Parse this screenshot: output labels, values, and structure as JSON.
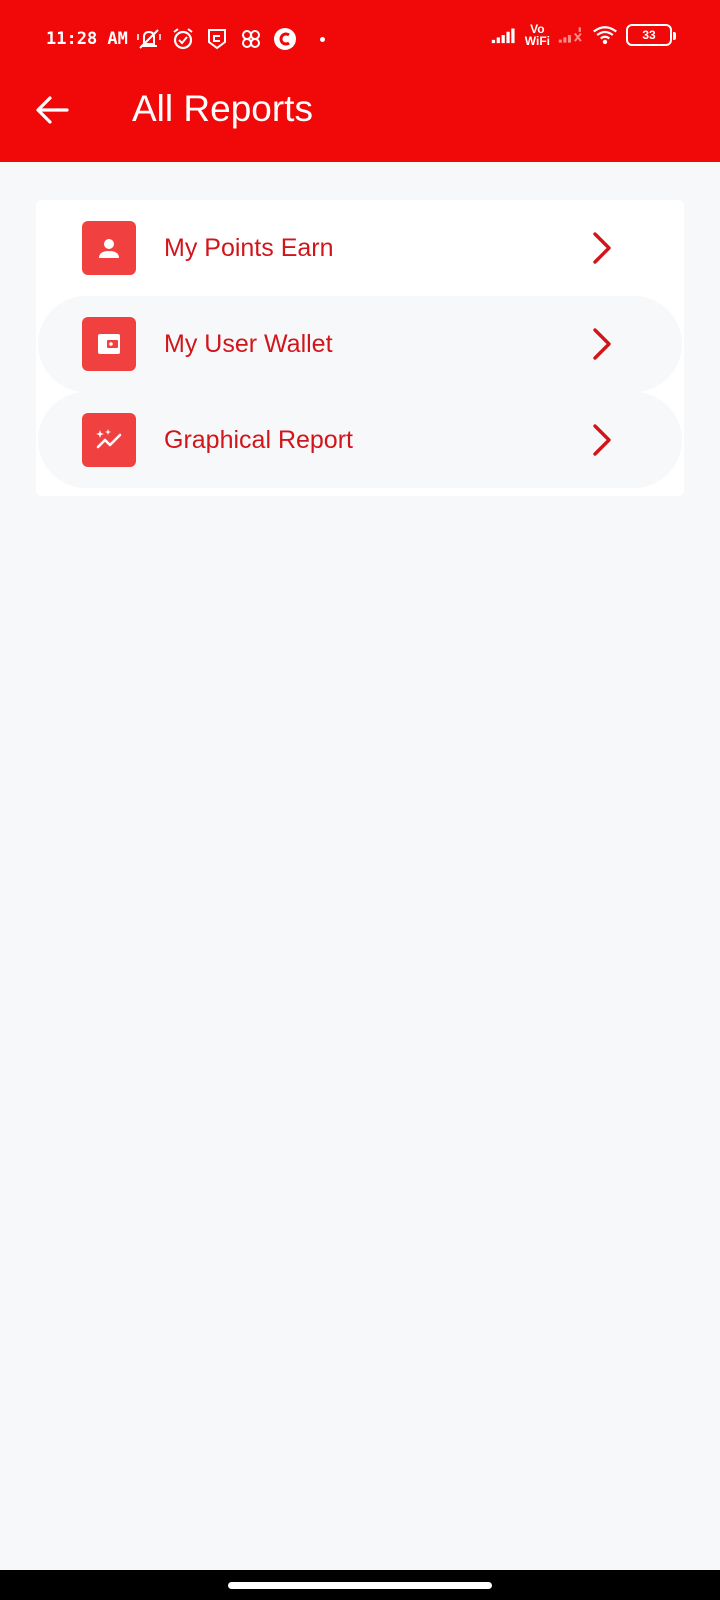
{
  "status_bar": {
    "time": "11:28 AM",
    "network_label_top": "Vo",
    "network_label_bottom": "WiFi",
    "battery": "33",
    "icons": [
      "mute-vibrate-icon",
      "alarm-icon",
      "pocket-app-icon",
      "pinwheel-icon",
      "c-app-icon",
      "signal-icon",
      "wifi-icon",
      "battery-icon"
    ]
  },
  "header": {
    "title": "All Reports",
    "back_icon": "arrow-left-icon"
  },
  "reports": {
    "items": [
      {
        "label": "My Points Earn",
        "icon": "person-icon"
      },
      {
        "label": "My User Wallet",
        "icon": "wallet-icon"
      },
      {
        "label": "Graphical Report",
        "icon": "sparkle-chart-icon"
      }
    ]
  },
  "colors": {
    "primary": "#f10909",
    "icon_bg": "#f0403f",
    "label": "#d1161b",
    "background": "#f7f8fa"
  }
}
